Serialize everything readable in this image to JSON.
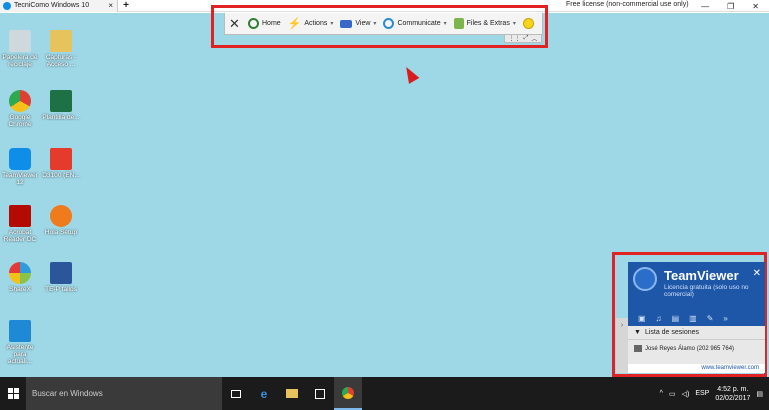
{
  "window": {
    "tab_title": "TecniComo Windows 10",
    "tab_close": "×",
    "new_tab": "+",
    "license": "Free license (non-commercial use only)",
    "min": "—",
    "max": "❐",
    "close": "✕"
  },
  "toolbar": {
    "close": "✕",
    "home": "Home",
    "actions": "Actions",
    "view": "View",
    "communicate": "Communicate",
    "files": "Files & Extras",
    "caret": "▾"
  },
  "desktop_icons": [
    {
      "label": "Papelera de reciclaje",
      "icon": "recycle-bin-icon",
      "color": "#cfd8dc"
    },
    {
      "label": "Capturas - Acceso ...",
      "icon": "folder-icon",
      "color": "#e6c35c"
    },
    {
      "label": "Google Chrome",
      "icon": "chrome-icon",
      "color": "#de4032"
    },
    {
      "label": "Plantilla de...",
      "icon": "excel-icon",
      "color": "#1e7145"
    },
    {
      "label": "TeamViewer 12",
      "icon": "teamviewer-icon",
      "color": "#0e8ee9"
    },
    {
      "label": "D3100 (EN...",
      "icon": "pdf-icon",
      "color": "#e43b2d"
    },
    {
      "label": "Acrobat Reader DC",
      "icon": "acrobat-icon",
      "color": "#b30b00"
    },
    {
      "label": "Hola Setup",
      "icon": "hola-icon",
      "color": "#f07b1c"
    },
    {
      "label": "ShareX",
      "icon": "sharex-icon",
      "color": "#2f9bd8"
    },
    {
      "label": "TE-P fallos",
      "icon": "word-icon",
      "color": "#2b579a"
    },
    {
      "label": "Asistente para actuali...",
      "icon": "windows-icon",
      "color": "#1e8ad6"
    }
  ],
  "tv_panel": {
    "title": "TeamViewer",
    "subtitle": "Licencia gratuita (solo uso no comercial)",
    "close": "✕",
    "list_header": "Lista de sesiones",
    "session": "José Reyes Álamo (202 965 764)",
    "footer": "www.teamviewer.com"
  },
  "taskbar": {
    "search_placeholder": "Buscar en Windows",
    "lang": "ESP",
    "time": "4:52 p. m.",
    "date": "02/02/2017"
  },
  "colors": {
    "desktop": "#9ed7e6",
    "highlight": "#e02222",
    "teamviewer_blue": "#1f57a8"
  }
}
